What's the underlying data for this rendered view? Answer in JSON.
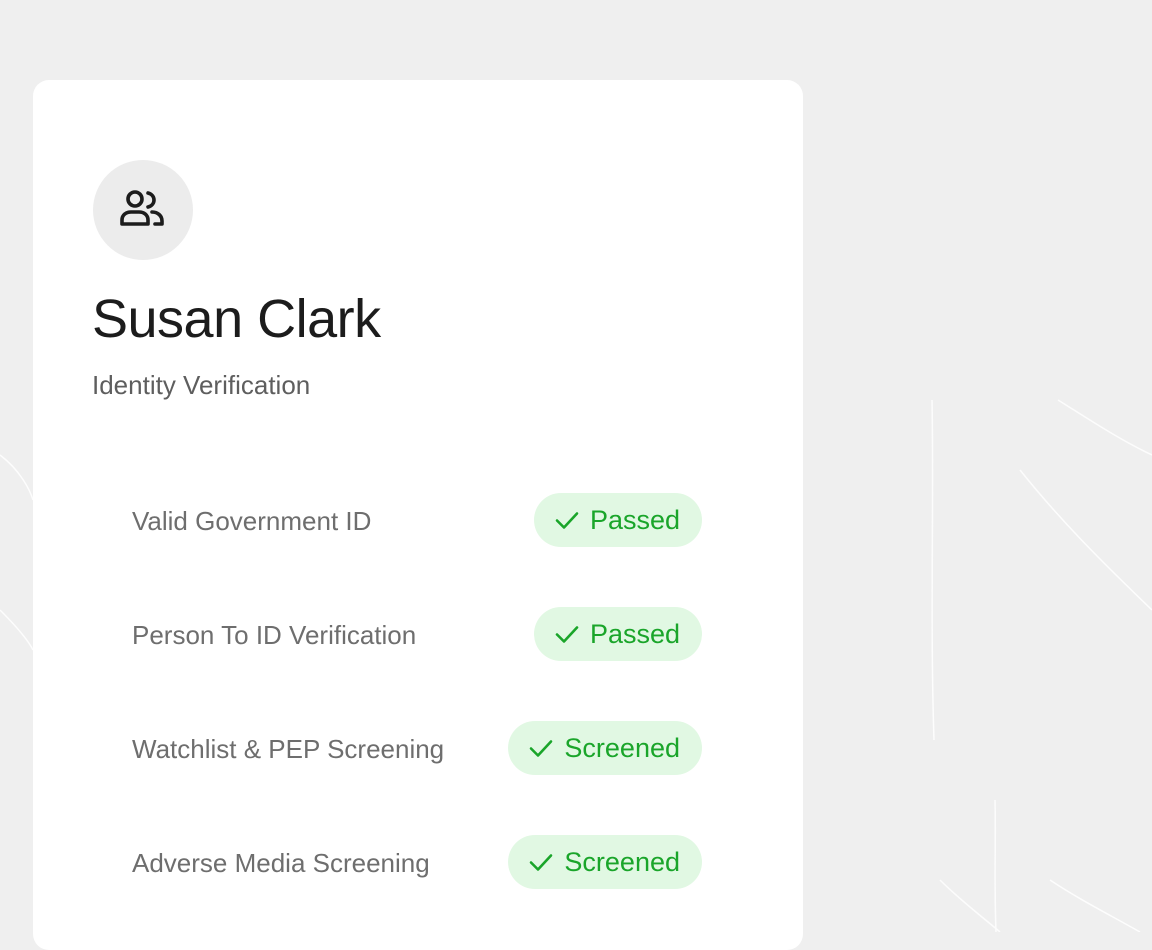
{
  "profile": {
    "name": "Susan Clark",
    "subtitle": "Identity Verification",
    "avatar_icon": "users-icon"
  },
  "checks": [
    {
      "label": "Valid Government ID",
      "status": "Passed",
      "icon": "check-icon"
    },
    {
      "label": "Person To ID Verification",
      "status": "Passed",
      "icon": "check-icon"
    },
    {
      "label": "Watchlist & PEP Screening",
      "status": "Screened",
      "icon": "check-icon"
    },
    {
      "label": "Adverse Media Screening",
      "status": "Screened",
      "icon": "check-icon"
    }
  ],
  "colors": {
    "page_background": "#efefef",
    "card_background": "#ffffff",
    "avatar_background": "#ececec",
    "badge_background": "#e1f8e3",
    "badge_text": "#1aa52a",
    "name_text": "#1c1c1c",
    "label_text": "#6e6e6e"
  }
}
